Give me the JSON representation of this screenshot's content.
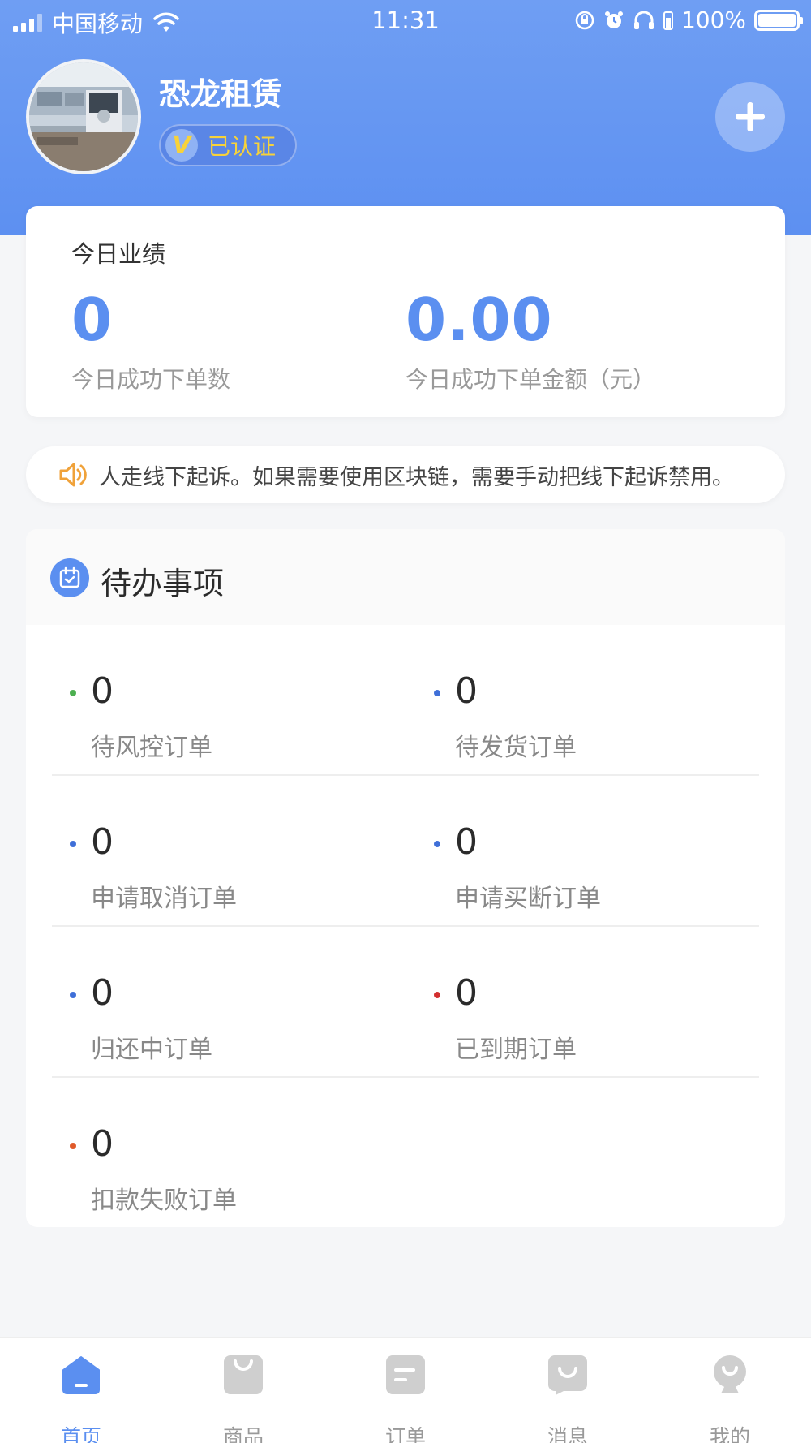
{
  "status_bar": {
    "carrier": "中国移动",
    "time": "11:31",
    "battery": "100%"
  },
  "profile": {
    "shop_name": "恐龙租赁",
    "badge_letter": "V",
    "verified_label": "已认证"
  },
  "performance": {
    "title": "今日业绩",
    "order_count": "0",
    "order_count_label": "今日成功下单数",
    "order_amount": "0.00",
    "order_amount_label": "今日成功下单金额（元）"
  },
  "notice": {
    "text": "人走线下起诉。如果需要使用区块链，需要手动把线下起诉禁用。"
  },
  "todo": {
    "title": "待办事项",
    "items": [
      {
        "count": "0",
        "label": "待风控订单",
        "dot_color": "#4caf50"
      },
      {
        "count": "0",
        "label": "待发货订单",
        "dot_color": "#3f6fd8"
      },
      {
        "count": "0",
        "label": "申请取消订单",
        "dot_color": "#3f6fd8"
      },
      {
        "count": "0",
        "label": "申请买断订单",
        "dot_color": "#3f6fd8"
      },
      {
        "count": "0",
        "label": "归还中订单",
        "dot_color": "#3f6fd8"
      },
      {
        "count": "0",
        "label": "已到期订单",
        "dot_color": "#d32f2f"
      },
      {
        "count": "0",
        "label": "扣款失败订单",
        "dot_color": "#e05a2b"
      }
    ]
  },
  "tab_bar": {
    "tabs": [
      {
        "label": "首页",
        "icon": "home-icon",
        "active": true
      },
      {
        "label": "商品",
        "icon": "bag-icon",
        "active": false
      },
      {
        "label": "订单",
        "icon": "order-icon",
        "active": false
      },
      {
        "label": "消息",
        "icon": "message-icon",
        "active": false
      },
      {
        "label": "我的",
        "icon": "profile-icon",
        "active": false
      }
    ]
  },
  "colors": {
    "accent": "#5b8ff0",
    "header_gradient": "#6f9ef3",
    "badge_text": "#f7d23a",
    "notice_icon": "#f0a23a",
    "inactive_tab": "#c9c9c9"
  }
}
